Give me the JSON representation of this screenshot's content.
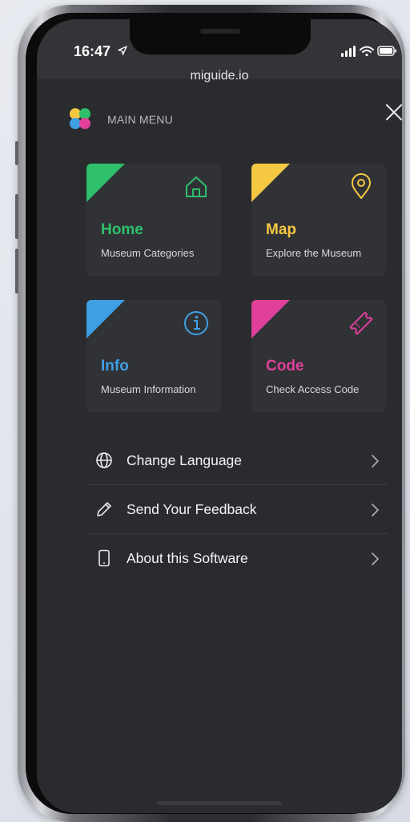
{
  "status_bar": {
    "time": "16:47"
  },
  "browser": {
    "url": "miguide.io"
  },
  "menu": {
    "title": "MAIN MENU"
  },
  "cards": [
    {
      "id": "home",
      "title": "Home",
      "subtitle": "Museum Categories",
      "color": "#2ebf6b",
      "icon": "home-icon"
    },
    {
      "id": "map",
      "title": "Map",
      "subtitle": "Explore the Museum",
      "color": "#f5c842",
      "icon": "location-pin-icon"
    },
    {
      "id": "info",
      "title": "Info",
      "subtitle": "Museum Information",
      "color": "#3f9fe3",
      "icon": "info-icon"
    },
    {
      "id": "code",
      "title": "Code",
      "subtitle": "Check Access Code",
      "color": "#e0409a",
      "icon": "ticket-icon"
    }
  ],
  "list": [
    {
      "label": "Change Language",
      "icon": "globe-icon"
    },
    {
      "label": "Send Your Feedback",
      "icon": "pencil-icon"
    },
    {
      "label": "About this Software",
      "icon": "mobile-device-icon"
    }
  ]
}
